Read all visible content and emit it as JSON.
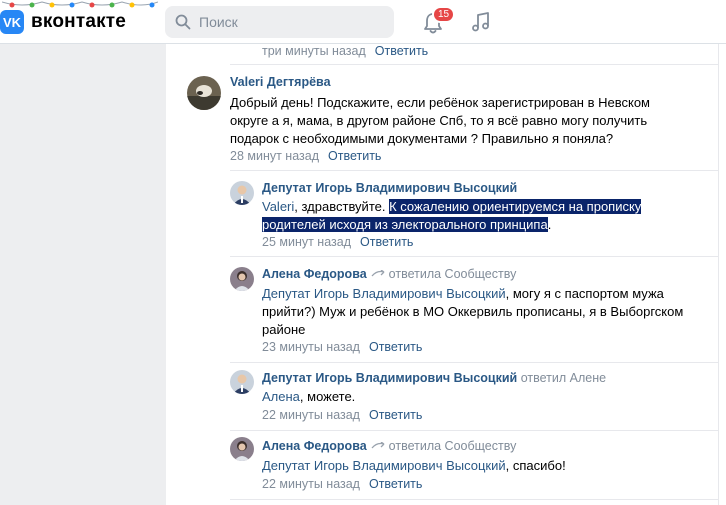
{
  "header": {
    "logo_glyph": "VK",
    "logo_text": "вконтакте",
    "search_placeholder": "Поиск",
    "notifications_count": "15",
    "icons": [
      "vk-logo-icon",
      "search-icon",
      "bell-icon",
      "music-icon"
    ]
  },
  "comments": {
    "top_meta_time": "три минуты назад",
    "reply_label": "Ответить",
    "c1": {
      "author": "Valeri Дегтярёва",
      "text": "Добрый день! Подскажите, если ребёнок зарегистрирован в Невском округе а я, мама, в другом районе Спб, то я всё равно могу получить подарок с необходимыми документами ? Правильно я поняла?",
      "time": "28 минут назад"
    },
    "c2": {
      "author": "Депутат Игорь Владимирович Высоцкий",
      "mention": "Valeri",
      "text_plain": ", здравствуйте. ",
      "text_selected": "К сожалению ориентируемся на прописку родителей исходя из электорального принципа",
      "text_end": ".",
      "time": "25 минут назад"
    },
    "c3": {
      "author": "Алена Федорова",
      "reply_to": "ответила Сообществу",
      "mention": "Депутат Игорь Владимирович Высоцкий",
      "text": ", могу я с паспортом мужа прийти?) Муж и ребёнок в МО Оккервиль прописаны, я в Выборгском районе",
      "time": "23 минуты назад"
    },
    "c4": {
      "author": "Депутат Игорь Владимирович Высоцкий",
      "reply_to": "ответил Алене",
      "mention": "Алена",
      "text": ", можете.",
      "time": "22 минуты назад"
    },
    "c5": {
      "author": "Алена Федорова",
      "reply_to": "ответила Сообществу",
      "mention": "Депутат Игорь Владимирович Высоцкий",
      "text": ", спасибо!",
      "time": "22 минуты назад"
    }
  },
  "colors": {
    "link": "#2a5885",
    "meta": "#818c99",
    "badge": "#e64646",
    "brand": "#2787f5",
    "selection": "#0a246a"
  }
}
